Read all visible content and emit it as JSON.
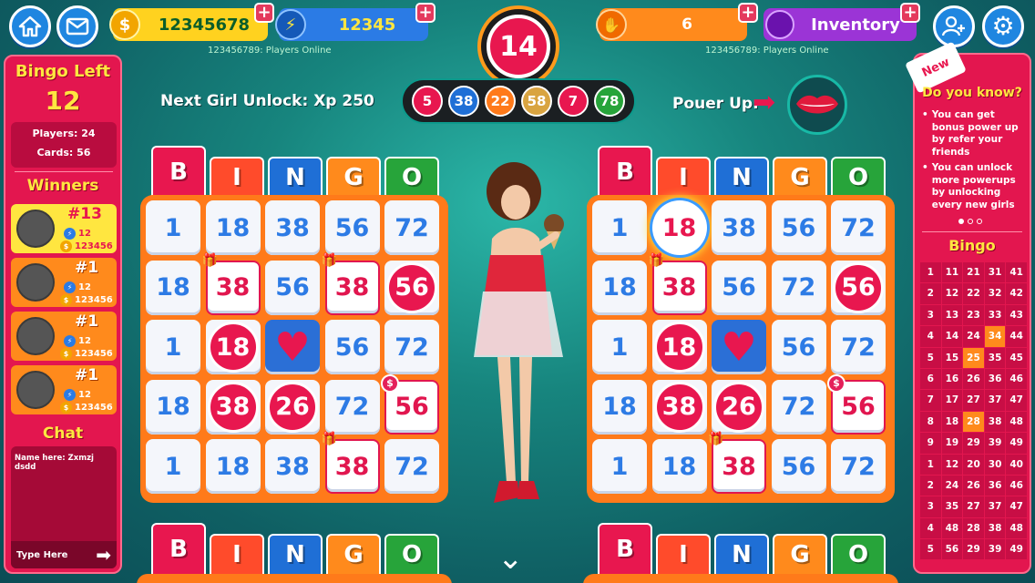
{
  "header": {
    "coins": "12345678",
    "energy": "12345",
    "players_online_left": "123456789: Players Online",
    "players_online_right": "123456789: Players Online",
    "current_ball": "14",
    "boost_count": "6",
    "inventory_label": "Inventory"
  },
  "left_panel": {
    "bingo_left_label": "Bingo Left",
    "bingo_left_count": "12",
    "players": "Players: 24",
    "cards": "Cards: 56",
    "winners_label": "Winners",
    "winners": [
      {
        "rank": "#13",
        "energy": "12",
        "coins": "123456"
      },
      {
        "rank": "#1",
        "energy": "12",
        "coins": "123456"
      },
      {
        "rank": "#1",
        "energy": "12",
        "coins": "123456"
      },
      {
        "rank": "#1",
        "energy": "12",
        "coins": "123456"
      }
    ],
    "chat_label": "Chat",
    "chat_message": "Name here: Zxmzj dsdd",
    "chat_placeholder": "Type Here"
  },
  "center": {
    "next_unlock": "Next Girl Unlock: Xp 250",
    "power_up_label": "Pouer Up:",
    "called_balls": [
      {
        "value": "5",
        "color": "#e8174f"
      },
      {
        "value": "38",
        "color": "#1f6fd6"
      },
      {
        "value": "22",
        "color": "#ff7a1a"
      },
      {
        "value": "58",
        "color": "#d9a441"
      },
      {
        "value": "7",
        "color": "#e8174f"
      },
      {
        "value": "78",
        "color": "#27a43a"
      }
    ]
  },
  "bingo_letters": [
    "B",
    "I",
    "N",
    "G",
    "O"
  ],
  "cards": [
    {
      "cells": [
        [
          "1",
          "18",
          "38",
          "56",
          "72"
        ],
        [
          "18",
          "38",
          "56",
          "38",
          "56"
        ],
        [
          "1",
          "18",
          "♥",
          "56",
          "72"
        ],
        [
          "18",
          "38",
          "26",
          "72",
          "56"
        ],
        [
          "1",
          "18",
          "38",
          "38",
          "72"
        ]
      ]
    },
    {
      "cells": [
        [
          "1",
          "18",
          "38",
          "56",
          "72"
        ],
        [
          "18",
          "38",
          "56",
          "72",
          "56"
        ],
        [
          "1",
          "18",
          "♥",
          "56",
          "72"
        ],
        [
          "18",
          "38",
          "26",
          "72",
          "56"
        ],
        [
          "1",
          "18",
          "38",
          "56",
          "72"
        ]
      ]
    }
  ],
  "right_panel": {
    "new_badge": "New",
    "did_you_know": "Do you know?",
    "tips": [
      "You can get bonus power up by refer your friends",
      "You can unlock more powerups by unlocking every new girls"
    ],
    "bingo_label": "Bingo",
    "number_grid": [
      [
        "1",
        "11",
        "21",
        "31",
        "41"
      ],
      [
        "2",
        "12",
        "22",
        "32",
        "42"
      ],
      [
        "3",
        "13",
        "23",
        "33",
        "43"
      ],
      [
        "4",
        "14",
        "24",
        "34",
        "44"
      ],
      [
        "5",
        "15",
        "25",
        "35",
        "45"
      ],
      [
        "6",
        "16",
        "26",
        "36",
        "46"
      ],
      [
        "7",
        "17",
        "27",
        "37",
        "47"
      ],
      [
        "8",
        "18",
        "28",
        "38",
        "48"
      ],
      [
        "9",
        "19",
        "29",
        "39",
        "49"
      ],
      [
        "1",
        "12",
        "20",
        "30",
        "40"
      ],
      [
        "2",
        "24",
        "26",
        "36",
        "46"
      ],
      [
        "3",
        "35",
        "27",
        "37",
        "47"
      ],
      [
        "4",
        "48",
        "28",
        "38",
        "48"
      ],
      [
        "5",
        "56",
        "29",
        "39",
        "49"
      ]
    ],
    "highlighted": [
      "3-3",
      "4-2",
      "7-2"
    ]
  },
  "colors": {
    "B": "#e8174f",
    "I": "#ff4b2b",
    "N": "#1f6fd6",
    "G": "#ff8a1c",
    "O": "#27a43a",
    "coins_bg": "#ffd21f",
    "energy_bg": "#2b7be5",
    "boost_bg": "#ff8a1c",
    "inventory_bg": "#9b34d6"
  }
}
